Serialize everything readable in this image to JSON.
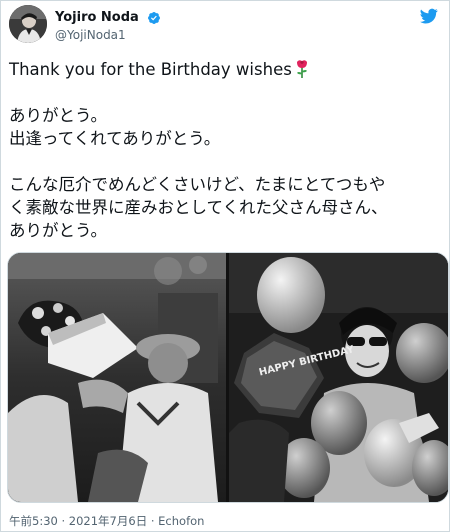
{
  "user": {
    "display_name": "Yojiro Noda",
    "handle": "@YojiNoda1",
    "verified_icon": "verified-badge-icon"
  },
  "tweet": {
    "line1": "Thank you for the Birthday wishes",
    "rose_icon": "rose-emoji-icon",
    "line2": "ありがとう。",
    "line3": "出逢ってくれてありがとう。",
    "line4": "こんな厄介でめんどくさいけど、たまにとてつもや",
    "line5": "く素敵な世界に産みおとしてくれた父さん母さん、",
    "line6": "ありがとう。"
  },
  "media": {
    "photo_right_balloon_text": "HAPPY BIRTHDAY"
  },
  "meta": {
    "timestamp": "午前5:30 · 2021年7月6日 · Echofon"
  },
  "colors": {
    "brand_blue": "#1d9bf0",
    "text_primary": "#0f1419",
    "text_secondary": "#536471",
    "rose_red": "#e0245e"
  }
}
